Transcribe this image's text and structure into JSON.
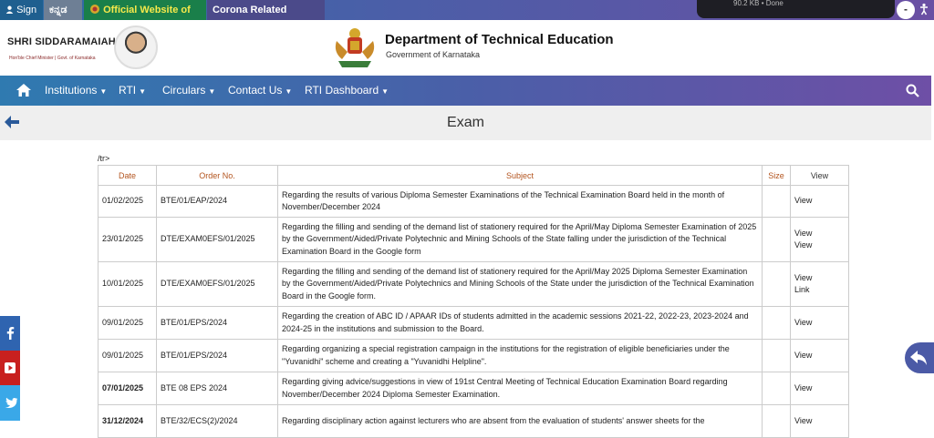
{
  "topbar": {
    "sign_in": "Sign In",
    "kannada": "ಕನ್ನಡ",
    "gok": "Official Website of GoK",
    "corona": "Corona Related Information",
    "download_status": "90.2 KB • Done",
    "minus": "-"
  },
  "header": {
    "cm_name": "SHRI SIDDARAMAIAH",
    "cm_title": "Hon'ble Chief Minister | Govt. of Karnataka",
    "dept_title": "Department of Technical Education",
    "dept_sub": "Government of Karnataka"
  },
  "nav": {
    "items": [
      "Institutions",
      "RTI",
      "Circulars",
      "Contact Us",
      "RTI Dashboard"
    ]
  },
  "page": {
    "title": "Exam",
    "stray_text": "/tr>"
  },
  "table": {
    "headers": [
      "Date",
      "Order No.",
      "Subject",
      "Size",
      "View"
    ],
    "rows": [
      {
        "date": "01/02/2025",
        "order": "BTE/01/EAP/2024",
        "subject": "Regarding the results of various Diploma Semester Examinations of the Technical Examination Board held in the month of November/December 2024",
        "size": "",
        "view": "View",
        "view2": "",
        "bold": false
      },
      {
        "date": "23/01/2025",
        "order": "DTE/EXAM0EFS/01/2025",
        "subject": "Regarding the filling and sending of the demand list of stationery required for the April/May Diploma Semester Examination of 2025 by the Government/Aided/Private Polytechnic and Mining Schools of the State falling under the jurisdiction of the Technical Examination Board in the Google form",
        "size": "",
        "view": "View",
        "view2": "View",
        "bold": false
      },
      {
        "date": "10/01/2025",
        "order": "DTE/EXAM0EFS/01/2025",
        "subject": "Regarding the filling and sending of the demand list of stationery required for the April/May 2025 Diploma Semester Examination by the Government/Aided/Private Polytechnics and Mining Schools of the State under the jurisdiction of the Technical Examination Board in the Google form.",
        "size": "",
        "view": "View",
        "view2": "Link",
        "bold": false
      },
      {
        "date": "09/01/2025",
        "order": "BTE/01/EPS/2024",
        "subject": "Regarding the creation of ABC ID / APAAR IDs of students admitted in the academic sessions 2021-22, 2022-23, 2023-2024 and 2024-25 in the institutions and submission to the Board.",
        "size": "",
        "view": "View",
        "view2": "",
        "bold": false
      },
      {
        "date": "09/01/2025",
        "order": "BTE/01/EPS/2024",
        "subject": "Regarding organizing a special registration campaign in the institutions for the registration of eligible beneficiaries under the \"Yuvanidhi\" scheme and creating a \"Yuvanidhi Helpline\".",
        "size": "",
        "view": "View",
        "view2": "",
        "bold": false
      },
      {
        "date": "07/01/2025",
        "order": "BTE 08 EPS 2024",
        "subject": "Regarding giving advice/suggestions in view of 191st Central Meeting of Technical Education Examination Board regarding November/December 2024 Diploma Semester Examination.",
        "size": "",
        "view": "View",
        "view2": "",
        "bold": true
      },
      {
        "date": "31/12/2024",
        "order": "BTE/32/ECS(2)/2024",
        "subject": "Regarding disciplinary action against lecturers who are absent from the evaluation of students' answer sheets for the",
        "size": "",
        "view": "View",
        "view2": "",
        "bold": true
      }
    ]
  },
  "colors": {
    "accent": "#4a5fa8",
    "header_text": "#b3541e"
  }
}
